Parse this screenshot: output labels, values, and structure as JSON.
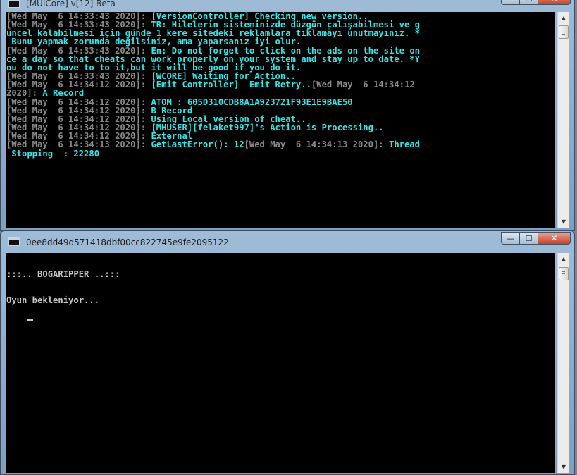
{
  "window_main": {
    "title": "[MUICore] v[12] Beta",
    "controls": {
      "minimize": "—",
      "maximize": "☐",
      "close": "✕"
    },
    "log_lines": [
      {
        "ts": "[Wed May  6 14:33:43 2020]: ",
        "msg": "[VersionController] Checking new version.."
      },
      {
        "ts": "[Wed May  6 14:33:43 2020]: ",
        "msg": "TR: Hilelerin sisteminizde düzgün çalışabilmesi ve g"
      },
      {
        "ts": "",
        "msg": "üncel kalabilmesi için günde 1 kere sitedeki reklamlara tıklamayı unutmayınız. *"
      },
      {
        "ts": "",
        "msg": " Bunu yapmak zorunda değilsiniz, ama yaparsanız iyi olur."
      },
      {
        "ts": "[Wed May  6 14:33:43 2020]: ",
        "msg": "En: Do not forget to click on the ads on the site on"
      },
      {
        "ts": "",
        "msg": "ce a day so that cheats can work properly on your system and stay up to date. *Y"
      },
      {
        "ts": "",
        "msg": "ou do not have to to it,but it will be good if you do it."
      },
      {
        "ts": "[Wed May  6 14:33:43 2020]: ",
        "msg": "[WCORE] Waiting for Action.."
      },
      {
        "ts": "[Wed May  6 14:34:12 2020]: ",
        "msg": "[Emit Controller]  Emit Retry..",
        "ts2": "[Wed May  6 14:34:12"
      },
      {
        "ts": "2020]: ",
        "msg": "A Record"
      },
      {
        "ts": "[Wed May  6 14:34:12 2020]: ",
        "msg": "ATOM : 605D310CDB8A1A923721F93E1E9BAE50"
      },
      {
        "ts": "[Wed May  6 14:34:12 2020]: ",
        "msg": "B Record"
      },
      {
        "ts": "[Wed May  6 14:34:12 2020]: ",
        "msg": "Using Local version of cheat.."
      },
      {
        "ts": "[Wed May  6 14:34:12 2020]: ",
        "msg": "[MHUSER][felaket997]'s Action is Processing.."
      },
      {
        "ts": "[Wed May  6 14:34:12 2020]: ",
        "msg": "External"
      },
      {
        "ts": "[Wed May  6 14:34:13 2020]: ",
        "msg": "GetLastError(): 12",
        "ts2": "[Wed May  6 14:34:13 2020]: ",
        "msg2": "Thread"
      },
      {
        "ts": "",
        "msg": " Stopping  : 22280"
      }
    ]
  },
  "window_secondary": {
    "title": "0ee8dd49d571418dbf00cc822745e9fe2095122",
    "controls": {
      "minimize": "—",
      "maximize": "☐",
      "close": "✕"
    },
    "lines": [
      ":::.. BOGARIPPER ..:::",
      "Oyun bekleniyor..."
    ]
  },
  "icons": {
    "app_icon": "console-window-icon",
    "scroll_up": "▲",
    "scroll_down": "▼"
  }
}
